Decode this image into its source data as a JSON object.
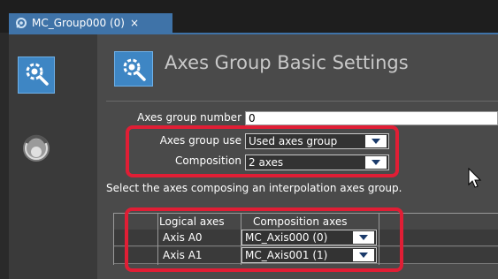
{
  "tab": {
    "title": "MC_Group000 (0)",
    "close_glyph": "×"
  },
  "header": {
    "title": "Axes Group Basic Settings"
  },
  "form": {
    "group_number_label": "Axes group number",
    "group_number_value": "0",
    "group_use_label": "Axes group use",
    "group_use_value": "Used axes group",
    "composition_label": "Composition",
    "composition_value": "2 axes"
  },
  "help_text": "Select the axes composing an interpolation axes group.",
  "axes_table": {
    "headers": [
      "Logical axes",
      "Composition axes"
    ],
    "rows": [
      {
        "logical": "Axis A0",
        "composition": "MC_Axis000 (0)"
      },
      {
        "logical": "Axis A1",
        "composition": "MC_Axis001 (1)"
      }
    ]
  },
  "icons": {
    "tab": "axes-group-icon",
    "sidebar_1": "basic-settings-icon",
    "sidebar_2": "axis-settings-icon",
    "header": "basic-settings-icon",
    "dropdown": "chevron-down-icon"
  },
  "colors": {
    "accent": "#3f73a8",
    "highlight": "#e01e35",
    "icon_blue": "#3e86c4",
    "panel": "#4a4a4a"
  }
}
